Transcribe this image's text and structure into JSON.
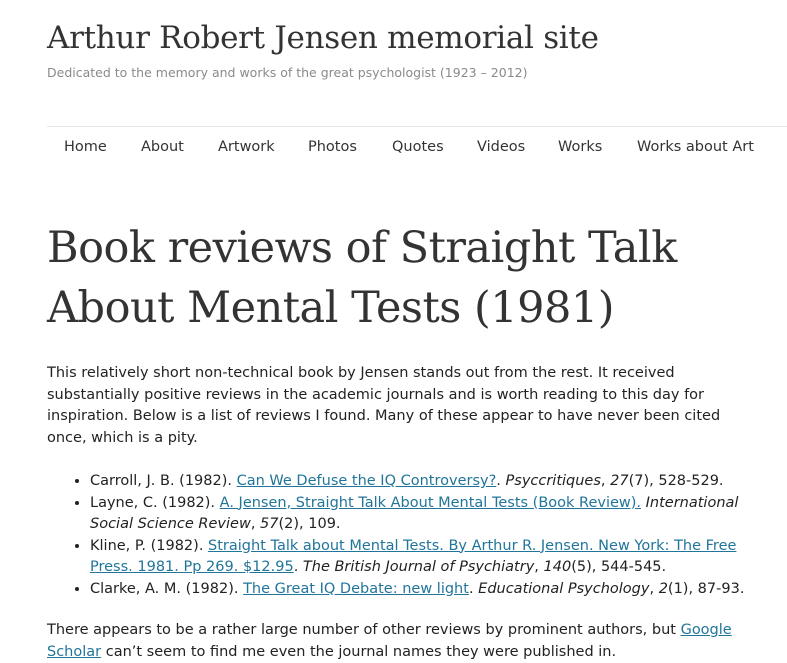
{
  "site": {
    "title": "Arthur Robert Jensen memorial site",
    "description": "Dedicated to the memory and works of the great psychologist (1923 – 2012)"
  },
  "nav": {
    "home": "Home",
    "about": "About",
    "artwork": "Artwork",
    "photos": "Photos",
    "quotes": "Quotes",
    "videos": "Videos",
    "works": "Works",
    "works_about": "Works about Art"
  },
  "page": {
    "title": "Book reviews of Straight Talk About Mental Tests (1981)",
    "intro": "This relatively short non-technical book by Jensen stands out from the rest. It received substantially positive reviews in the academic journals and is worth reading to this day for inspiration. Below is a list of reviews I found. Many of these appear to have never been cited once, which is a pity.",
    "reviews": [
      {
        "prefix": "Carroll, J. B. (1982). ",
        "link": "Can We Defuse the IQ Controversy?",
        "after_link": ". ",
        "journal": "Psyccritiques",
        "sep": ", ",
        "volume": "27",
        "rest": "(7), 528-529."
      },
      {
        "prefix": "Layne, C. (1982). ",
        "link": "A. Jensen, Straight Talk About Mental Tests (Book Review).",
        "after_link": " ",
        "journal": "International Social Science Review",
        "sep": ", ",
        "volume": "57",
        "rest": "(2), 109."
      },
      {
        "prefix": "Kline, P. (1982). ",
        "link": "Straight Talk about Mental Tests. By Arthur R. Jensen. New York: The Free Press. 1981. Pp 269. $12.95",
        "after_link": ". ",
        "journal": "The British Journal of Psychiatry",
        "sep": ", ",
        "volume": "140",
        "rest": "(5), 544-545."
      },
      {
        "prefix": "Clarke, A. M. (1982). ",
        "link": "The Great IQ Debate: new light",
        "after_link": ". ",
        "journal": "Educational Psychology",
        "sep": ", ",
        "volume": "2",
        "rest": "(1), 87-93."
      }
    ],
    "outro_before": "There appears to be a rather large number of other reviews by prominent authors, but ",
    "outro_link": "Google Scholar",
    "outro_after": " can’t seem to find me even the journal names they were published in."
  }
}
